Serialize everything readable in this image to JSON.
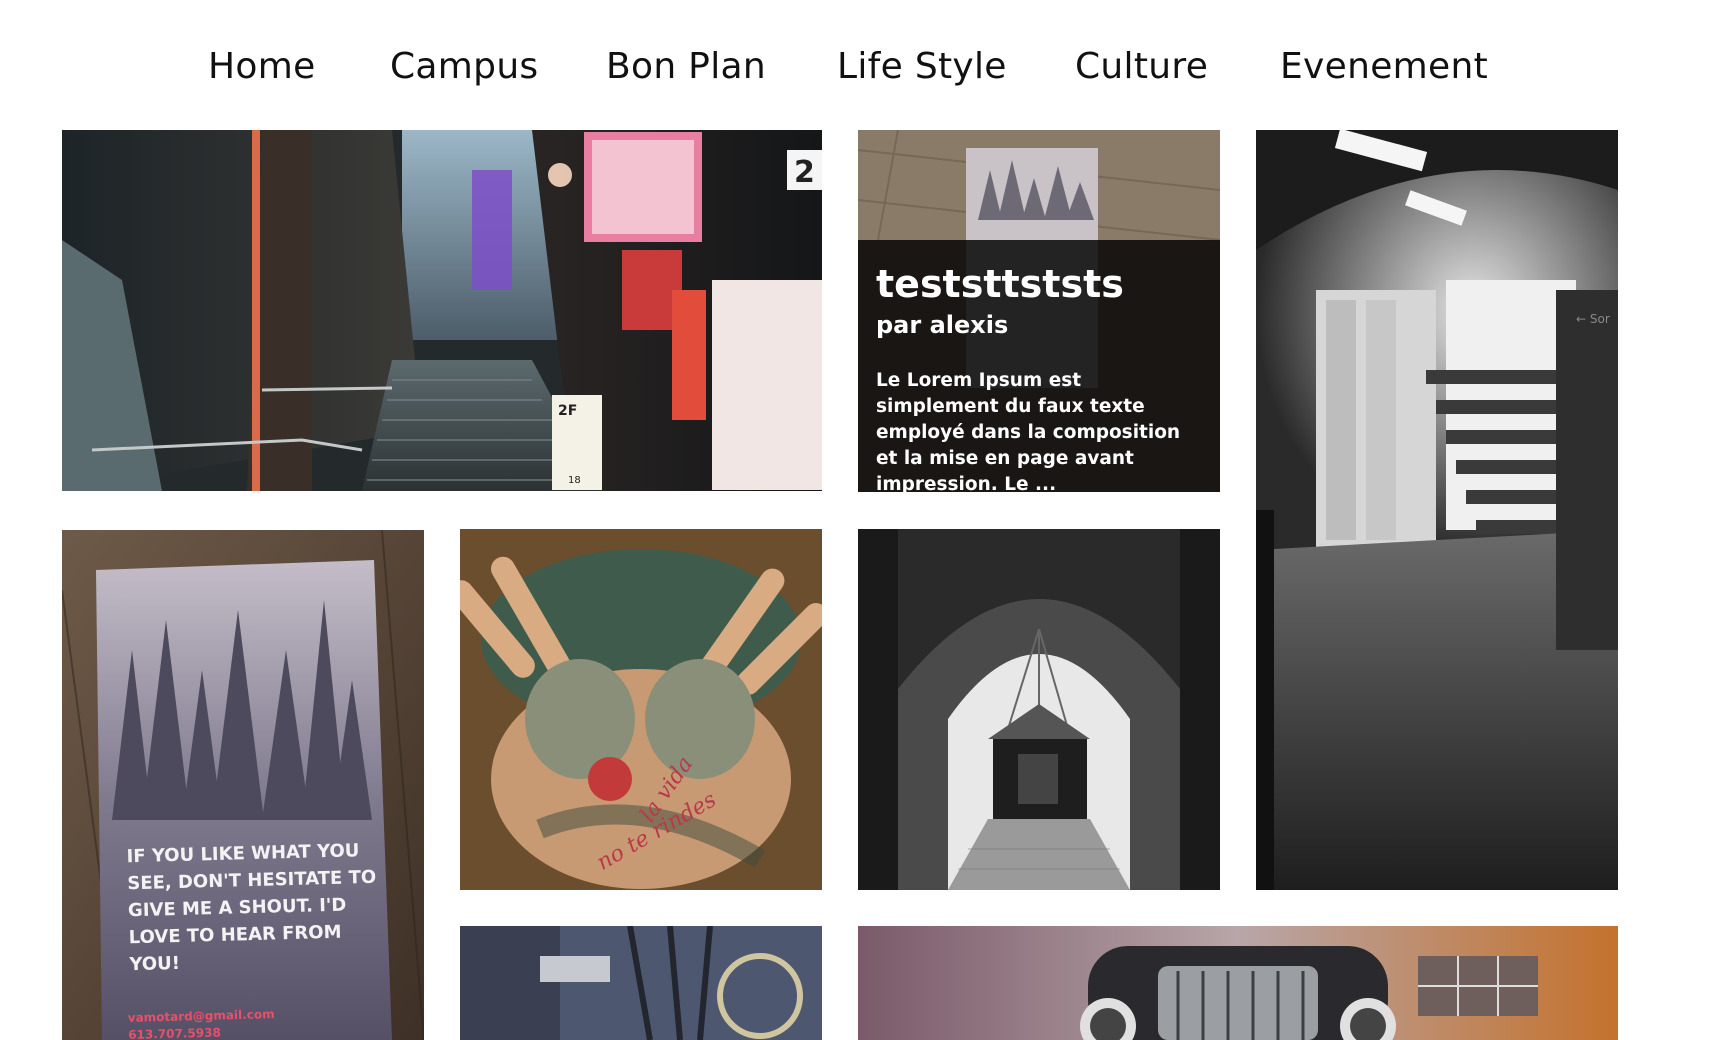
{
  "nav": {
    "items": [
      {
        "label": "Home"
      },
      {
        "label": "Campus"
      },
      {
        "label": "Bon Plan"
      },
      {
        "label": "Life Style"
      },
      {
        "label": "Culture"
      },
      {
        "label": "Evenement"
      }
    ]
  },
  "featured_post": {
    "title": "teststtststs",
    "author": "par alexis",
    "excerpt": "Le Lorem Ipsum est simplement du faux texte employé dans la composition et la mise en page avant impression. Le ..."
  },
  "brochure": {
    "text": "IF YOU LIKE WHAT YOU SEE, DON'T HESITATE TO GIVE ME A SHOUT. I'D LOVE TO HEAR FROM YOU!",
    "email": "vamotard@gmail.com",
    "phone": "613.707.5938"
  },
  "street_signs": {
    "floor_sign": "2F",
    "number_sign": "2",
    "stair_sign": "18"
  },
  "tattoo_text": {
    "line1": "la vida",
    "line2": "no te rindes"
  },
  "subway_sign": "← Sor",
  "colors": {
    "background": "#ffffff",
    "nav_text": "#111111",
    "overlay": "#000000",
    "overlay_text": "#ffffff",
    "accent_pink": "#e94f6a"
  }
}
